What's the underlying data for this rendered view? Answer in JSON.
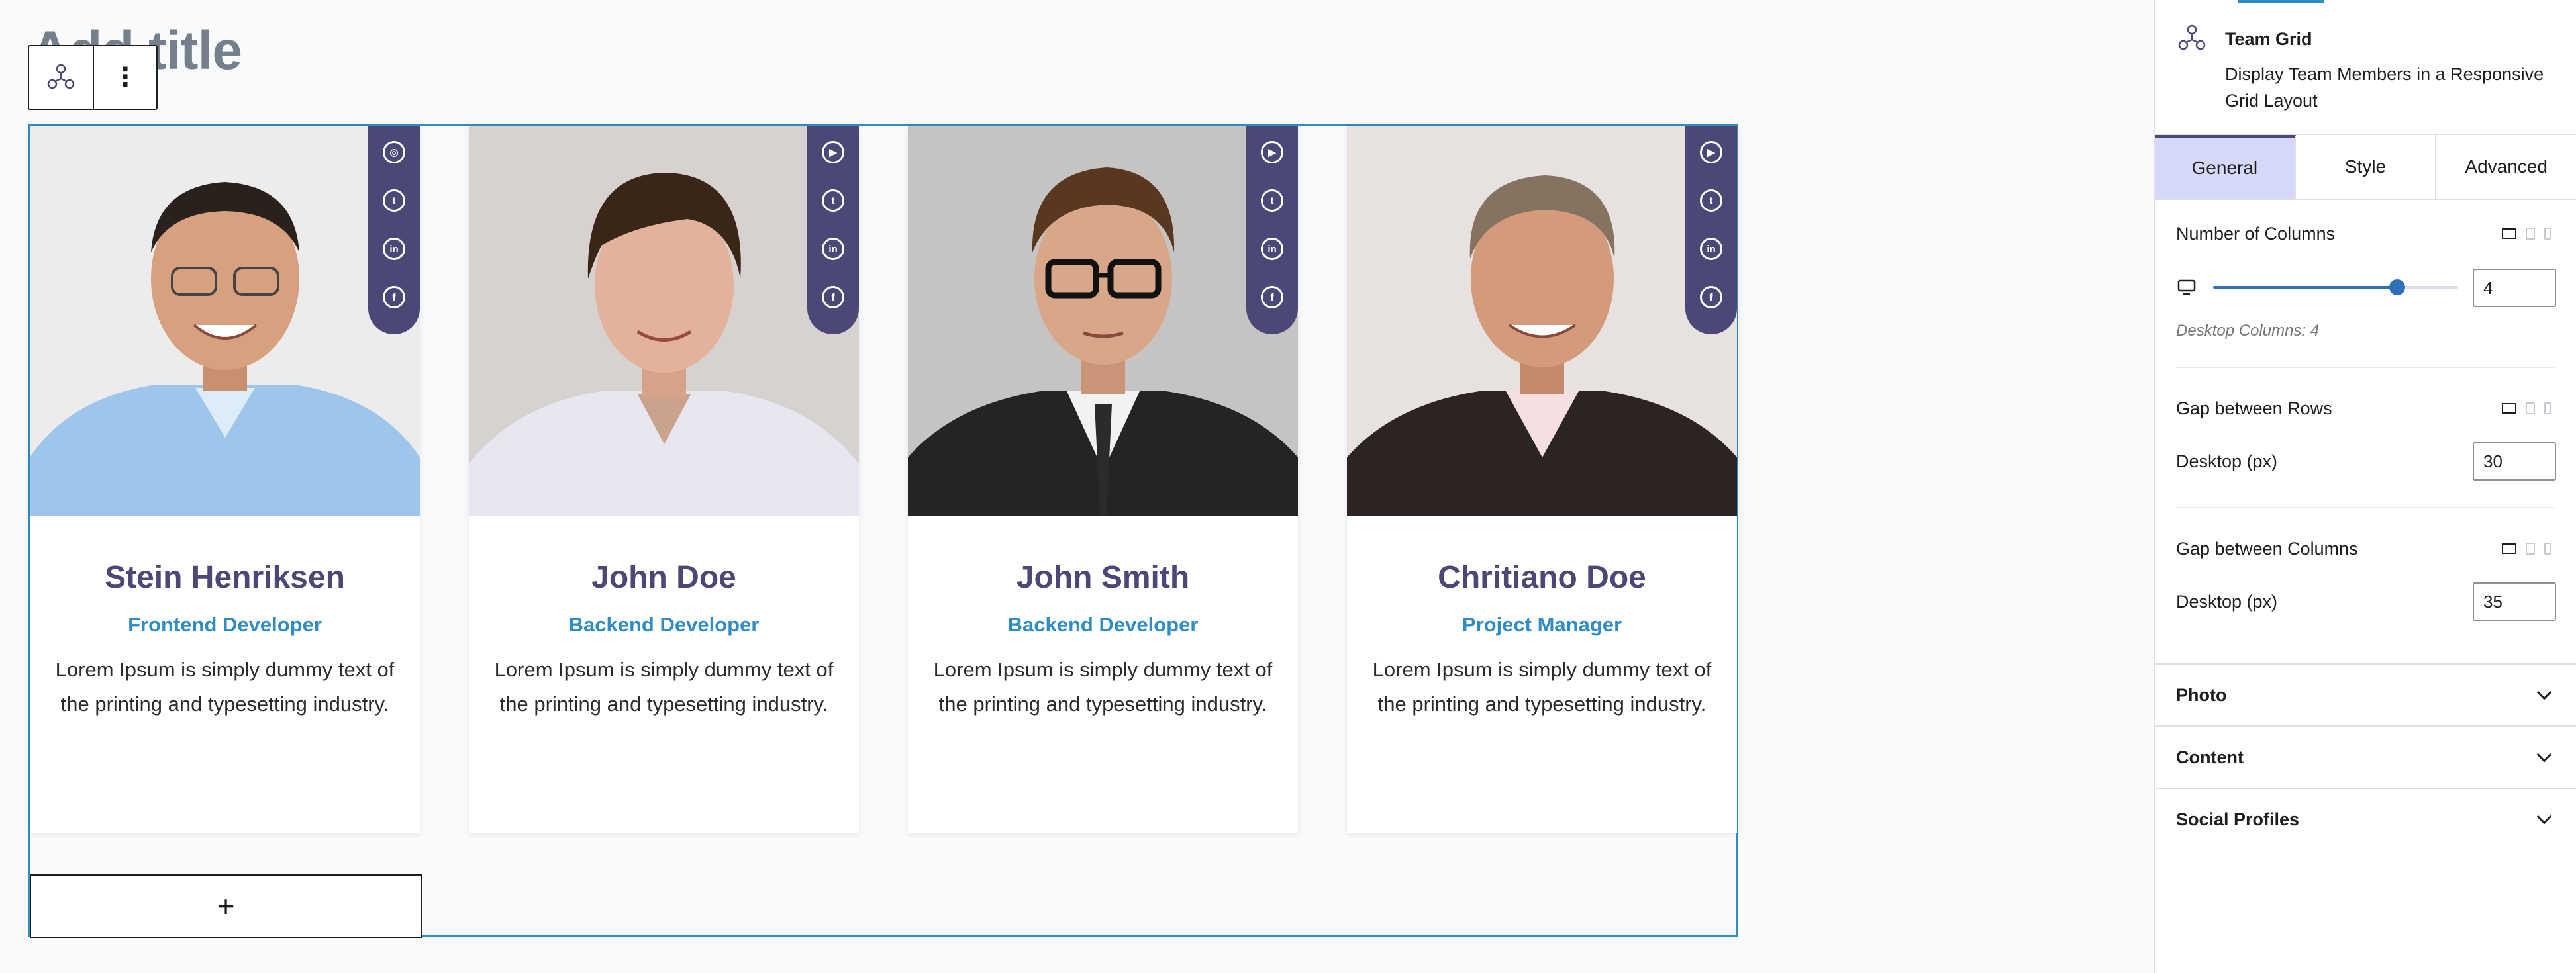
{
  "editor": {
    "page_title": "Add title",
    "add_item_label": "+"
  },
  "colors": {
    "accent_purple": "#4b4878",
    "accent_blue": "#2f8dc4",
    "tab_active_bg": "#d5d8fb"
  },
  "team": [
    {
      "name": "Stein Henriksen",
      "role": "Frontend Developer",
      "bio": "Lorem Ipsum is simply dummy text of the printing and typesetting industry.",
      "social": [
        "instagram-icon",
        "twitter-icon",
        "linkedin-icon",
        "facebook-icon"
      ]
    },
    {
      "name": "John Doe",
      "role": "Backend Developer",
      "bio": "Lorem Ipsum is simply dummy text of the printing and typesetting industry.",
      "social": [
        "youtube-icon",
        "twitter-icon",
        "linkedin-icon",
        "facebook-icon"
      ]
    },
    {
      "name": "John Smith",
      "role": "Backend Developer",
      "bio": "Lorem Ipsum is simply dummy text of the printing and typesetting industry.",
      "social": [
        "youtube-icon",
        "twitter-icon",
        "linkedin-icon",
        "facebook-icon"
      ]
    },
    {
      "name": "Chritiano Doe",
      "role": "Project Manager",
      "bio": "Lorem Ipsum is simply dummy text of the printing and typesetting industry.",
      "social": [
        "youtube-icon",
        "twitter-icon",
        "linkedin-icon",
        "facebook-icon"
      ]
    }
  ],
  "sidebar": {
    "block": {
      "title": "Team Grid",
      "description": "Display Team Members in a Responsive Grid Layout"
    },
    "tabs": [
      "General",
      "Style",
      "Advanced"
    ],
    "active_tab": "General",
    "columns": {
      "label": "Number of Columns",
      "value": "4",
      "fraction": 0.75,
      "help": "Desktop Columns: 4"
    },
    "row_gap": {
      "label": "Gap between Rows",
      "sub_label": "Desktop (px)",
      "value": "30"
    },
    "column_gap": {
      "label": "Gap between Columns",
      "sub_label": "Desktop (px)",
      "value": "35"
    },
    "accordions": [
      "Photo",
      "Content",
      "Social Profiles"
    ]
  }
}
